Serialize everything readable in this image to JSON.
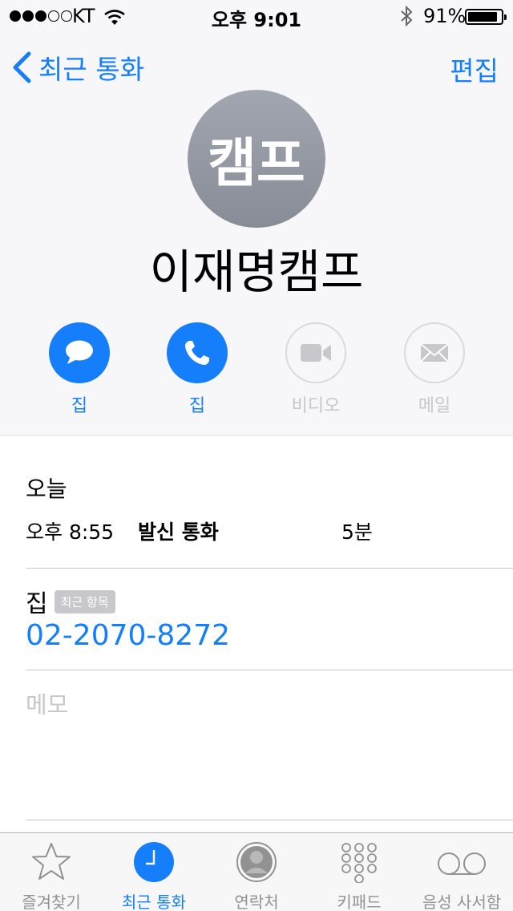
{
  "status_bar": {
    "carrier": "KT",
    "time": "오후 9:01",
    "battery": "91%",
    "signal_bars_filled": 3,
    "signal_bars_total": 5
  },
  "nav": {
    "back_label": "최근 통화",
    "edit_label": "편집"
  },
  "contact": {
    "avatar_text": "캠프",
    "name": "이재명캠프"
  },
  "actions": {
    "message_label": "집",
    "call_label": "집",
    "video_label": "비디오",
    "mail_label": "메일"
  },
  "call_log": {
    "date_header": "오늘",
    "entries": [
      {
        "time": "오후 8:55",
        "type": "발신 통화",
        "duration": "5분"
      }
    ]
  },
  "phone": {
    "label": "집",
    "badge": "최근 항목",
    "number": "02-2070-8272"
  },
  "notes": {
    "placeholder": "메모"
  },
  "tab_bar": {
    "tabs": [
      {
        "label": "즐겨찾기",
        "icon": "star-icon"
      },
      {
        "label": "최근 통화",
        "icon": "clock-icon"
      },
      {
        "label": "연락처",
        "icon": "contacts-icon"
      },
      {
        "label": "키패드",
        "icon": "keypad-icon"
      },
      {
        "label": "음성 사서함",
        "icon": "voicemail-icon"
      }
    ],
    "active_index": 1
  },
  "colors": {
    "accent": "#147efb",
    "disabled": "#c7c7cc",
    "tab_inactive": "#929292"
  }
}
